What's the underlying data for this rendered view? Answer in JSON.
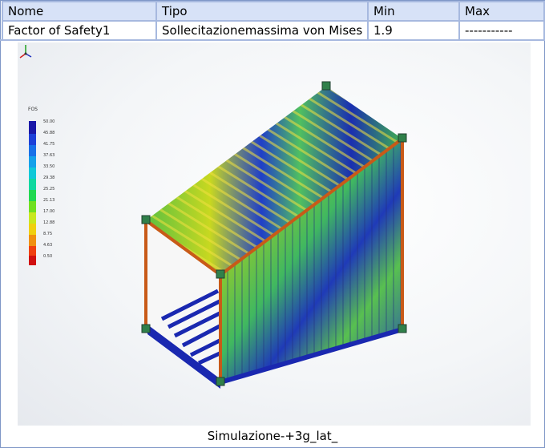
{
  "table": {
    "headers": [
      "Nome",
      "Tipo",
      "Min",
      "Max"
    ],
    "row": [
      "Factor of Safety1",
      "Sollecitazionemassima von Mises",
      "1.9",
      "-----------"
    ]
  },
  "legend": {
    "title": "FOS",
    "ticks": [
      "50.00",
      "45.88",
      "41.75",
      "37.63",
      "33.50",
      "29.38",
      "25.25",
      "21.13",
      "17.00",
      "12.88",
      "8.75",
      "4.63",
      "0.50"
    ],
    "colors": [
      "#1a18a8",
      "#1d40d8",
      "#1870e8",
      "#14a0ea",
      "#10c8d8",
      "#10d8a0",
      "#20d850",
      "#70e020",
      "#c8e820",
      "#f0d010",
      "#f09010",
      "#f04010",
      "#d01010"
    ]
  },
  "caption": "Simulazione-+3g_lat_"
}
